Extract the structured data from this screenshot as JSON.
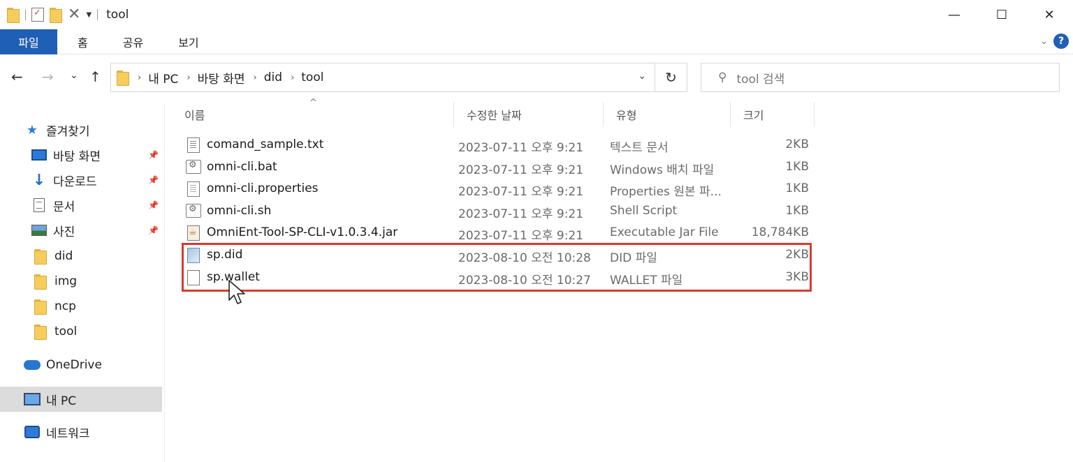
{
  "window": {
    "title": "tool",
    "controls": {
      "minimize": "—",
      "maximize": "☐",
      "close": "✕"
    }
  },
  "ribbon": {
    "tabs": [
      "파일",
      "홈",
      "공유",
      "보기"
    ],
    "help": "?"
  },
  "nav": {
    "back": "←",
    "forward": "→",
    "recent": "⌄",
    "up": "↑",
    "breadcrumbs": [
      "내 PC",
      "바탕 화면",
      "did",
      "tool"
    ],
    "refresh": "↻",
    "search_placeholder": "tool 검색"
  },
  "sidebar": {
    "quick_access_label": "즐겨찾기",
    "pinned": [
      {
        "label": "바탕 화면",
        "icon": "desktop-icon"
      },
      {
        "label": "다운로드",
        "icon": "download-icon"
      },
      {
        "label": "문서",
        "icon": "documents-icon"
      },
      {
        "label": "사진",
        "icon": "pictures-icon"
      }
    ],
    "folders": [
      "did",
      "img",
      "ncp",
      "tool"
    ],
    "onedrive": "OneDrive",
    "this_pc": "내 PC",
    "network": "네트워크"
  },
  "columns": {
    "name": "이름",
    "date": "수정한 날짜",
    "type": "유형",
    "size": "크기"
  },
  "files": [
    {
      "name": "comand_sample.txt",
      "date": "2023-07-11 오후 9:21",
      "type": "텍스트 문서",
      "size": "2KB",
      "icon": "text-file-icon"
    },
    {
      "name": "omni-cli.bat",
      "date": "2023-07-11 오후 9:21",
      "type": "Windows 배치 파일",
      "size": "1KB",
      "icon": "batch-file-icon"
    },
    {
      "name": "omni-cli.properties",
      "date": "2023-07-11 오후 9:21",
      "type": "Properties 원본 파...",
      "size": "1KB",
      "icon": "properties-file-icon"
    },
    {
      "name": "omni-cli.sh",
      "date": "2023-07-11 오후 9:21",
      "type": "Shell Script",
      "size": "1KB",
      "icon": "shell-script-icon"
    },
    {
      "name": "OmniEnt-Tool-SP-CLI-v1.0.3.4.jar",
      "date": "2023-07-11 오후 9:21",
      "type": "Executable Jar File",
      "size": "18,784KB",
      "icon": "jar-file-icon"
    },
    {
      "name": "sp.did",
      "date": "2023-08-10 오전 10:28",
      "type": "DID 파일",
      "size": "2KB",
      "icon": "did-file-icon"
    },
    {
      "name": "sp.wallet",
      "date": "2023-08-10 오전 10:27",
      "type": "WALLET 파일",
      "size": "3KB",
      "icon": "wallet-file-icon"
    }
  ],
  "colors": {
    "accent": "#1f5fb6",
    "highlight_border": "#d93a30"
  }
}
